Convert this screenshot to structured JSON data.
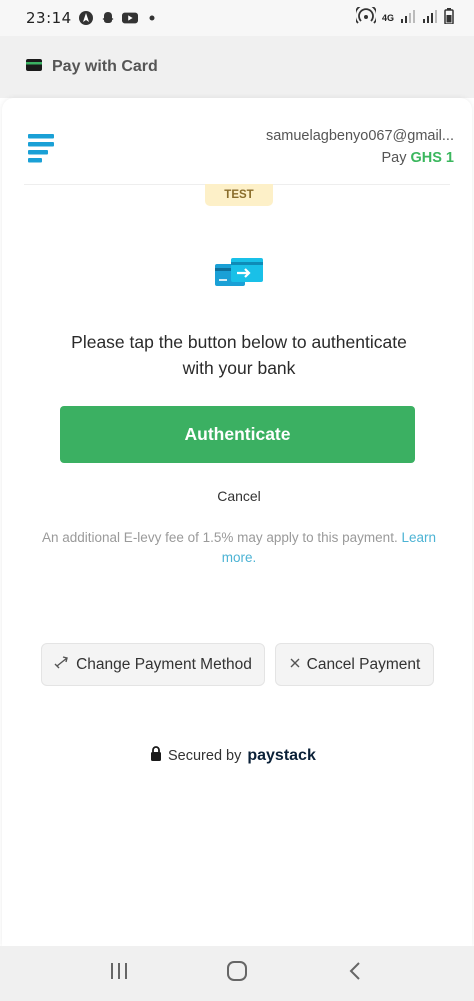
{
  "status_bar": {
    "time": "23:14",
    "network_label": "4G"
  },
  "header": {
    "title": "Pay with Card"
  },
  "merchant": {
    "email": "samuelagbenyo067@gmail...",
    "pay_prefix": "Pay",
    "amount": "GHS 1"
  },
  "badge": {
    "label": "TEST"
  },
  "main": {
    "instructions": "Please tap the button below to authenticate with your bank",
    "authenticate_label": "Authenticate",
    "cancel_label": "Cancel",
    "levy_text": "An additional E-levy fee of 1.5% may apply to this payment.",
    "learn_more_label": "Learn more."
  },
  "actions": {
    "change_payment_label": "Change Payment Method",
    "cancel_payment_label": "Cancel Payment"
  },
  "footer": {
    "secured_prefix": "Secured by",
    "brand": "paystack"
  },
  "colors": {
    "primary_green": "#3bb062",
    "amount_green": "#3bb75e",
    "link_blue": "#4cb3d4",
    "test_badge_bg": "#fdf0c8",
    "logo_blue": "#1aa0d6"
  },
  "icons": {
    "card": "card-icon",
    "bank_transfer": "bank-transfer-icon",
    "swap": "swap-icon",
    "close": "close-icon",
    "lock": "lock-icon"
  }
}
